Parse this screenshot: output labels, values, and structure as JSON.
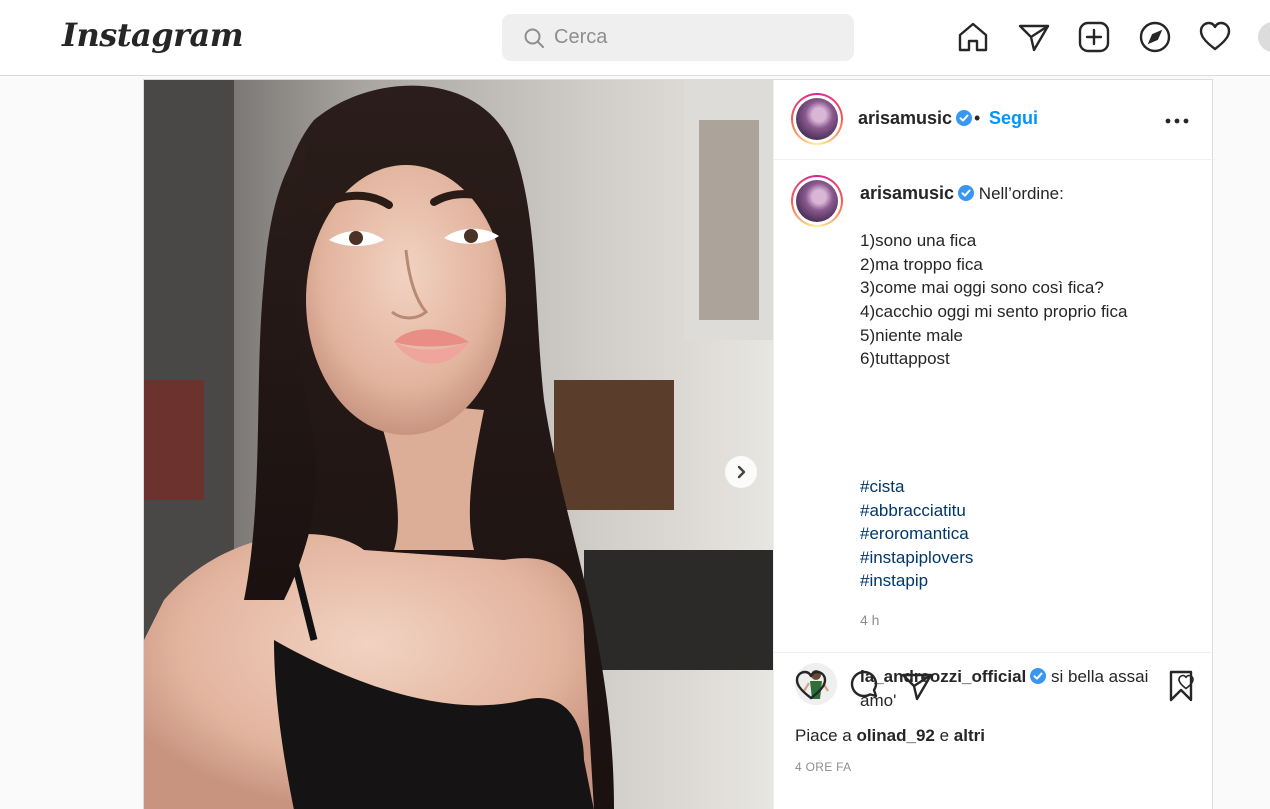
{
  "app": {
    "logo_text": "Instagram"
  },
  "search": {
    "placeholder": "Cerca"
  },
  "nav": {
    "icons": [
      "home-icon",
      "direct-icon",
      "new-post-icon",
      "explore-icon",
      "activity-icon",
      "profile-avatar"
    ]
  },
  "post": {
    "author": "arisamusic",
    "verified": true,
    "follow_label": "Segui",
    "separator": "•",
    "caption_intro": "Nell’ordine:",
    "caption_lines": [
      "1)sono una fica",
      "2)ma troppo fica",
      "3)come mai oggi sono così fica?",
      "4)cacchio oggi mi sento proprio fica",
      "5)niente male",
      "6)tuttappost"
    ],
    "hashtags": [
      "#cista",
      "#abbracciatitu",
      "#eroromantica",
      "#instapiplovers",
      "#instapip"
    ],
    "caption_age": "4 h",
    "comment": {
      "author": "la_andreozzi_official",
      "verified": true,
      "text": "si bella assai amo'"
    },
    "likes": {
      "prefix": "Piace a",
      "user": "olinad_92",
      "conjunction": "e",
      "others": "altri"
    },
    "timestamp": "4 ORE FA"
  },
  "colors": {
    "accent": "#0095f6",
    "hashtag": "#00376b",
    "verified": "#3897f0",
    "muted": "#8e8e8e"
  }
}
